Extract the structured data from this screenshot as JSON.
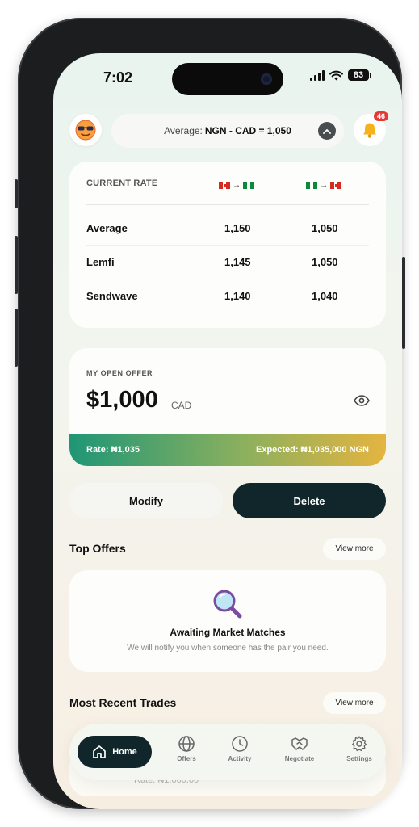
{
  "status_bar": {
    "time": "7:02",
    "battery": "83"
  },
  "header": {
    "rate_pill_prefix": "Average:",
    "rate_pill_value": "NGN - CAD = 1,050",
    "notification_count": "46",
    "avatar_icon": "sunglasses-emoji-icon",
    "bell_icon": "bell-icon"
  },
  "current_rate": {
    "heading": "CURRENT RATE",
    "columns": [
      {
        "from": "CA",
        "to": "NG"
      },
      {
        "from": "NG",
        "to": "CA"
      }
    ],
    "rows": [
      {
        "name": "Average",
        "cad_ngn": "1,150",
        "ngn_cad": "1,050"
      },
      {
        "name": "Lemfi",
        "cad_ngn": "1,145",
        "ngn_cad": "1,050"
      },
      {
        "name": "Sendwave",
        "cad_ngn": "1,140",
        "ngn_cad": "1,040"
      }
    ]
  },
  "open_offer": {
    "label": "MY OPEN OFFER",
    "amount": "$1,000",
    "currency": "CAD",
    "rate": "Rate: ₦1,035",
    "expected": "Expected: ₦1,035,000 NGN"
  },
  "actions": {
    "modify": "Modify",
    "delete": "Delete"
  },
  "top_offers": {
    "title": "Top Offers",
    "view_more": "View more",
    "empty_title": "Awaiting Market Matches",
    "empty_subtitle": "We will notify you when someone has the pair you need."
  },
  "recent_trades": {
    "title": "Most Recent Trades",
    "view_more": "View more",
    "partial_row_text": "Rate: ₦1,000.00"
  },
  "nav": {
    "home": "Home",
    "offers": "Offers",
    "activity": "Activity",
    "negotiate": "Negotiate",
    "settings": "Settings"
  },
  "colors": {
    "dark_accent": "#10262a",
    "gradient_start": "#1f9676",
    "gradient_end": "#e4b440",
    "badge_red": "#e53935"
  }
}
